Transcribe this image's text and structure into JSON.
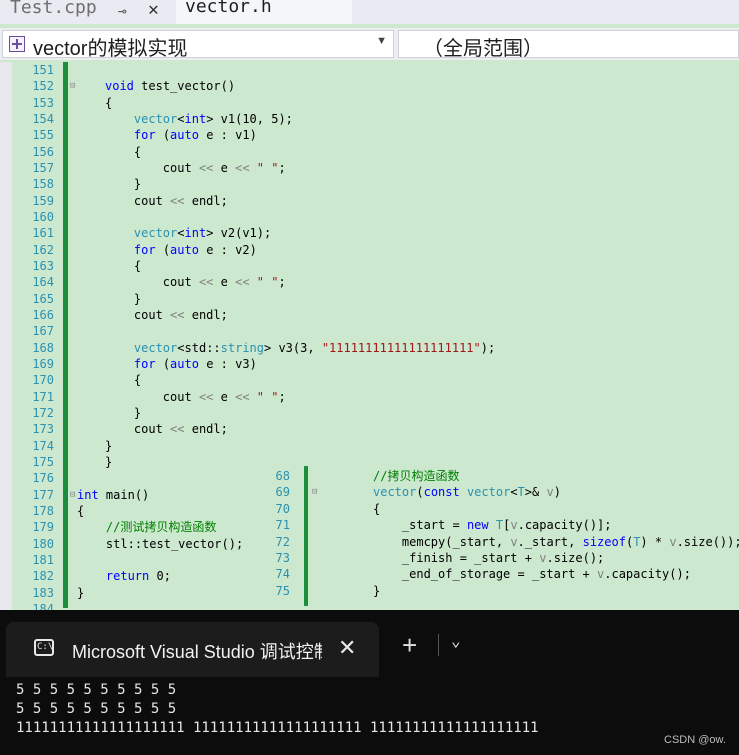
{
  "tabs": {
    "test": {
      "label": "Test.cpp",
      "pin": "⊸",
      "close": "✕"
    },
    "vector": {
      "label": "vector.h"
    }
  },
  "nav": {
    "scope": "vector的模拟实现",
    "global": "（全局范围）"
  },
  "editor": {
    "lines": [
      {
        "n": "151",
        "t": ""
      },
      {
        "n": "152",
        "t": "void test_vector()"
      },
      {
        "n": "153",
        "t": "{"
      },
      {
        "n": "154",
        "t": "    vector<int> v1(10, 5);"
      },
      {
        "n": "155",
        "t": "    for (auto e : v1)"
      },
      {
        "n": "156",
        "t": "    {"
      },
      {
        "n": "157",
        "t": "        cout << e << \" \";"
      },
      {
        "n": "158",
        "t": "    }"
      },
      {
        "n": "159",
        "t": "    cout << endl;"
      },
      {
        "n": "160",
        "t": ""
      },
      {
        "n": "161",
        "t": "    vector<int> v2(v1);"
      },
      {
        "n": "162",
        "t": "    for (auto e : v2)"
      },
      {
        "n": "163",
        "t": "    {"
      },
      {
        "n": "164",
        "t": "        cout << e << \" \";"
      },
      {
        "n": "165",
        "t": "    }"
      },
      {
        "n": "166",
        "t": "    cout << endl;"
      },
      {
        "n": "167",
        "t": ""
      },
      {
        "n": "168",
        "t": "    vector<std::string> v3(3, \"11111111111111111111\");"
      },
      {
        "n": "169",
        "t": "    for (auto e : v3)"
      },
      {
        "n": "170",
        "t": "    {"
      },
      {
        "n": "171",
        "t": "        cout << e << \" \";"
      },
      {
        "n": "172",
        "t": "    }"
      },
      {
        "n": "173",
        "t": "    cout << endl;"
      },
      {
        "n": "174",
        "t": "}"
      },
      {
        "n": "175",
        "t": "}"
      },
      {
        "n": "176",
        "t": ""
      },
      {
        "n": "177",
        "t": "int main()"
      },
      {
        "n": "178",
        "t": "{"
      },
      {
        "n": "179",
        "t": "    //测试拷贝构造函数"
      },
      {
        "n": "180",
        "t": "    stl::test_vector();"
      },
      {
        "n": "181",
        "t": ""
      },
      {
        "n": "182",
        "t": "    return 0;"
      },
      {
        "n": "183",
        "t": "}"
      },
      {
        "n": "184",
        "t": ""
      }
    ],
    "peek": [
      {
        "n": "68",
        "t": "//拷贝构造函数"
      },
      {
        "n": "69",
        "t": "vector(const vector<T>& v)"
      },
      {
        "n": "70",
        "t": "{"
      },
      {
        "n": "71",
        "t": "    _start = new T[v.capacity()];"
      },
      {
        "n": "72",
        "t": "    memcpy(_start, v._start, sizeof(T) * v.size());"
      },
      {
        "n": "73",
        "t": "    _finish = _start + v.size();"
      },
      {
        "n": "74",
        "t": "    _end_of_storage = _start + v.capacity();"
      },
      {
        "n": "75",
        "t": "}"
      }
    ]
  },
  "terminal": {
    "icon_text": "C:\\",
    "title": "Microsoft Visual Studio 调试控制台",
    "close": "✕",
    "new_tab": "+",
    "dropdown": "⌄",
    "output": [
      "5 5 5 5 5 5 5 5 5 5",
      "5 5 5 5 5 5 5 5 5 5",
      "11111111111111111111 11111111111111111111 11111111111111111111"
    ]
  },
  "watermark": "CSDN @ow."
}
